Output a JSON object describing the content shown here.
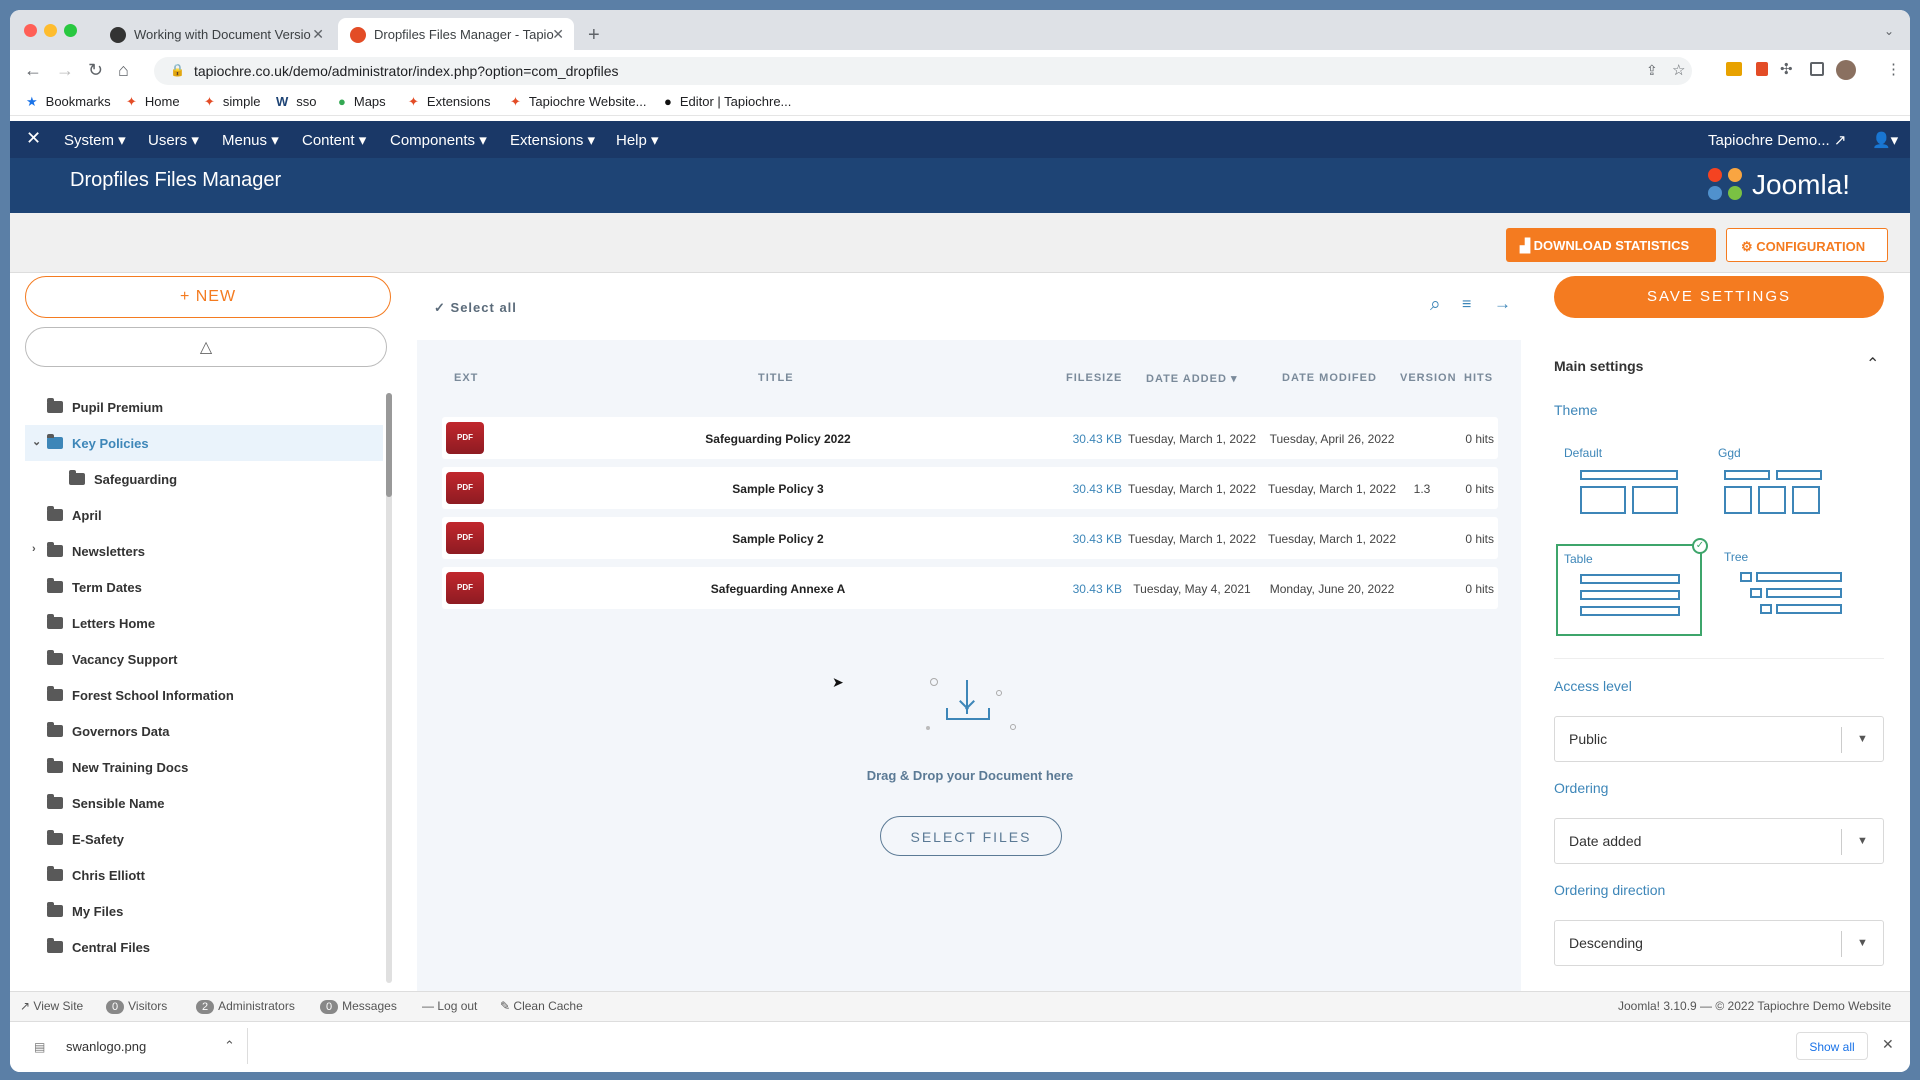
{
  "browser": {
    "tabs": [
      {
        "title": "Working with Document Versio"
      },
      {
        "title": "Dropfiles Files Manager - Tapio"
      }
    ],
    "url": "tapiochre.co.uk/demo/administrator/index.php?option=com_dropfiles",
    "bookmarks": [
      "Bookmarks",
      "Home",
      "simple",
      "sso",
      "Maps",
      "Extensions",
      "Tapiochre Website...",
      "Editor | Tapiochre..."
    ]
  },
  "joomla": {
    "menu": [
      "System",
      "Users",
      "Menus",
      "Content",
      "Components",
      "Extensions",
      "Help"
    ],
    "site_name": "Tapiochre Demo...",
    "page_title": "Dropfiles Files Manager",
    "logo_text": "Joomla!",
    "download_stats_label": "DOWNLOAD STATISTICS",
    "configuration_label": "CONFIGURATION"
  },
  "left": {
    "new_label": "+ NEW",
    "folders": [
      {
        "name": "Pupil Premium",
        "level": 0,
        "active": false,
        "expander": ""
      },
      {
        "name": "Key Policies",
        "level": 0,
        "active": true,
        "expander": "v"
      },
      {
        "name": "Safeguarding",
        "level": 1,
        "active": false,
        "expander": ""
      },
      {
        "name": "April",
        "level": 0,
        "active": false,
        "expander": ""
      },
      {
        "name": "Newsletters",
        "level": 0,
        "active": false,
        "expander": ">"
      },
      {
        "name": "Term Dates",
        "level": 0,
        "active": false,
        "expander": ""
      },
      {
        "name": "Letters Home",
        "level": 0,
        "active": false,
        "expander": ""
      },
      {
        "name": "Vacancy Support",
        "level": 0,
        "active": false,
        "expander": ""
      },
      {
        "name": "Forest School Information",
        "level": 0,
        "active": false,
        "expander": ""
      },
      {
        "name": "Governors Data",
        "level": 0,
        "active": false,
        "expander": ""
      },
      {
        "name": "New Training Docs",
        "level": 0,
        "active": false,
        "expander": ""
      },
      {
        "name": "Sensible Name",
        "level": 0,
        "active": false,
        "expander": ""
      },
      {
        "name": "E-Safety",
        "level": 0,
        "active": false,
        "expander": ""
      },
      {
        "name": "Chris Elliott",
        "level": 0,
        "active": false,
        "expander": ""
      },
      {
        "name": "My Files",
        "level": 0,
        "active": false,
        "expander": ""
      },
      {
        "name": "Central Files",
        "level": 0,
        "active": false,
        "expander": ""
      }
    ]
  },
  "main": {
    "select_all": "Select all",
    "columns": [
      "EXT",
      "TITLE",
      "FILESIZE",
      "DATE ADDED",
      "DATE MODIFED",
      "VERSION",
      "HITS"
    ],
    "files": [
      {
        "ext": "PDF",
        "title": "Safeguarding Policy 2022",
        "size": "30.43 KB",
        "added": "Tuesday, March 1, 2022",
        "modified": "Tuesday, April 26, 2022",
        "version": "",
        "hits": "0 hits"
      },
      {
        "ext": "PDF",
        "title": "Sample Policy 3",
        "size": "30.43 KB",
        "added": "Tuesday, March 1, 2022",
        "modified": "Tuesday, March 1, 2022",
        "version": "1.3",
        "hits": "0 hits"
      },
      {
        "ext": "PDF",
        "title": "Sample Policy 2",
        "size": "30.43 KB",
        "added": "Tuesday, March 1, 2022",
        "modified": "Tuesday, March 1, 2022",
        "version": "",
        "hits": "0 hits"
      },
      {
        "ext": "PDF",
        "title": "Safeguarding Annexe A",
        "size": "30.43 KB",
        "added": "Tuesday, May 4, 2021",
        "modified": "Monday, June 20, 2022",
        "version": "",
        "hits": "0 hits"
      }
    ],
    "drop_text": "Drag & Drop your Document here",
    "select_files": "SELECT FILES"
  },
  "right": {
    "save_label": "SAVE SETTINGS",
    "section": "Main settings",
    "theme_label": "Theme",
    "themes": [
      "Default",
      "Ggd",
      "Table",
      "Tree"
    ],
    "selected_theme": "Table",
    "access_label": "Access level",
    "access_value": "Public",
    "ordering_label": "Ordering",
    "ordering_value": "Date added",
    "direction_label": "Ordering direction",
    "direction_value": "Descending"
  },
  "status": {
    "view_site": "View Site",
    "visitors_count": "0",
    "visitors": "Visitors",
    "admins_count": "2",
    "admins": "Administrators",
    "messages_count": "0",
    "messages": "Messages",
    "logout": "Log out",
    "clean_cache": "Clean Cache",
    "version": "Joomla! 3.10.9  —  © 2022 Tapiochre Demo Website"
  },
  "download": {
    "filename": "swanlogo.png",
    "show_all": "Show all"
  },
  "colors": {
    "accent": "#f47b20",
    "navy": "#1a3867",
    "link": "#3d86b8",
    "pdf": "#b3202a"
  }
}
